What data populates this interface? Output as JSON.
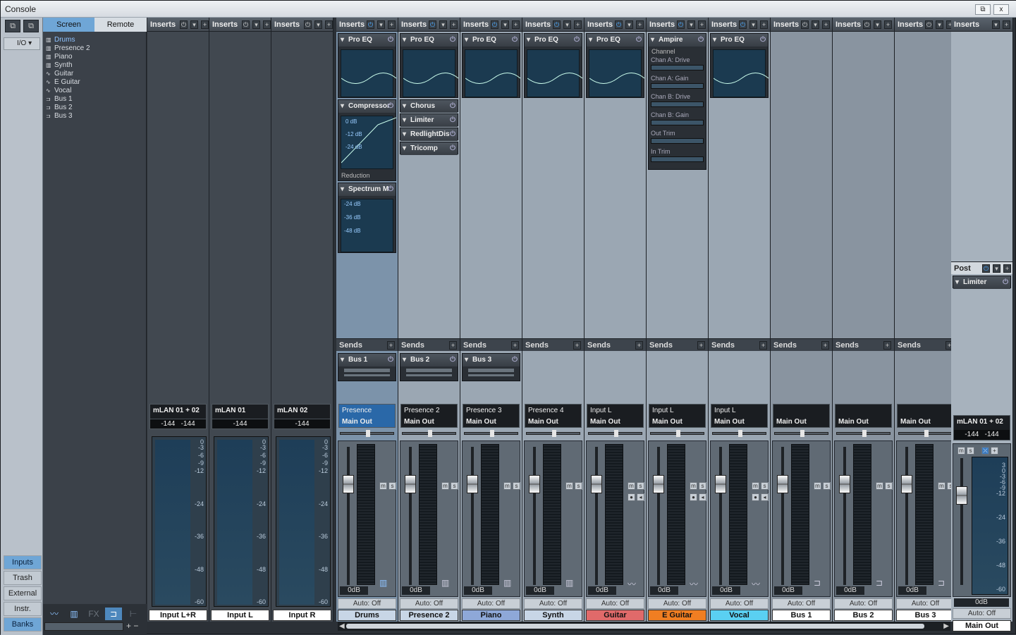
{
  "window": {
    "title": "Console",
    "restore_label": "⧉",
    "close_label": "x"
  },
  "left": {
    "io_label": "I/O",
    "tabs": [
      {
        "label": "Inputs"
      },
      {
        "label": "Trash"
      },
      {
        "label": "External"
      },
      {
        "label": "Instr."
      },
      {
        "label": "Banks"
      }
    ]
  },
  "browser": {
    "tab_screen": "Screen",
    "tab_remote": "Remote",
    "items": [
      {
        "label": "Drums",
        "icon": "keyboard-icon"
      },
      {
        "label": "Presence 2",
        "icon": "keyboard-icon"
      },
      {
        "label": "Piano",
        "icon": "keyboard-icon"
      },
      {
        "label": "Synth",
        "icon": "keyboard-icon"
      },
      {
        "label": "Guitar",
        "icon": "wave-icon"
      },
      {
        "label": "E Guitar",
        "icon": "wave-icon"
      },
      {
        "label": "Vocal",
        "icon": "wave-icon"
      },
      {
        "label": "Bus 1",
        "icon": "bus-icon"
      },
      {
        "label": "Bus 2",
        "icon": "bus-icon"
      },
      {
        "label": "Bus 3",
        "icon": "bus-icon"
      }
    ]
  },
  "labels": {
    "inserts": "Inserts",
    "sends": "Sends",
    "post": "Post",
    "auto": "Auto: Off",
    "db": "0dB",
    "reduction": "Reduction",
    "channel": "Channel"
  },
  "inputs": [
    {
      "src": "mLAN 01 + 02",
      "level": "-144   -144",
      "name": "Input L+R"
    },
    {
      "src": "mLAN 01",
      "level": "-144",
      "name": "Input L"
    },
    {
      "src": "mLAN 02",
      "level": "-144",
      "name": "Input R"
    }
  ],
  "meter_ticks": [
    "0",
    "-3",
    "-6",
    "-9",
    "-12",
    "-24",
    "-36",
    "-48",
    "-60"
  ],
  "channels": [
    {
      "name": "Drums",
      "in": "Presence",
      "out": "Main Out",
      "color": "#c8d6e6",
      "inserts": [
        "Pro EQ",
        "Compressor",
        "Spectrum M"
      ],
      "send": "Bus 1"
    },
    {
      "name": "Presence 2",
      "in": "Presence 2",
      "out": "Main Out",
      "color": "#c8d6e6",
      "inserts": [
        "Pro EQ",
        "Chorus",
        "Limiter",
        "RedlightDis",
        "Tricomp"
      ],
      "send": "Bus 2"
    },
    {
      "name": "Piano",
      "in": "Presence 3",
      "out": "Main Out",
      "color": "#8ea8d8",
      "inserts": [
        "Pro EQ"
      ],
      "send": "Bus 3"
    },
    {
      "name": "Synth",
      "in": "Presence 4",
      "out": "Main Out",
      "color": "#c8d6e6",
      "inserts": [
        "Pro EQ"
      ],
      "send": ""
    },
    {
      "name": "Guitar",
      "in": "Input L",
      "out": "Main Out",
      "color": "#e06a6a",
      "inserts": [
        "Pro EQ"
      ],
      "send": ""
    },
    {
      "name": "E Guitar",
      "in": "Input L",
      "out": "Main Out",
      "color": "#f07e22",
      "inserts": [
        "Ampire"
      ],
      "send": ""
    },
    {
      "name": "Vocal",
      "in": "Input L",
      "out": "Main Out",
      "color": "#5ad0f2",
      "inserts": [
        "Pro EQ"
      ],
      "send": ""
    },
    {
      "name": "Bus 1",
      "in": "",
      "out": "Main Out",
      "color": "#ffffff",
      "inserts": [],
      "send": ""
    },
    {
      "name": "Bus 2",
      "in": "",
      "out": "Main Out",
      "color": "#ffffff",
      "inserts": [],
      "send": ""
    },
    {
      "name": "Bus 3",
      "in": "",
      "out": "Main Out",
      "color": "#ffffff",
      "inserts": [],
      "send": ""
    }
  ],
  "compressor": {
    "ticks": [
      "0 dB",
      "-12 dB",
      "-24 dB"
    ]
  },
  "spectrum": {
    "ticks": [
      "-24 dB",
      "-36 dB",
      "-48 dB"
    ]
  },
  "ampire": {
    "params": [
      "Chan A: Drive",
      "Chan A: Gain",
      "Chan B: Drive",
      "Chan B: Gain",
      "Out Trim",
      "In Trim"
    ]
  },
  "main": {
    "src": "mLAN 01 + 02",
    "level": "-144   -144",
    "post_insert": "Limiter",
    "name": "Main Out",
    "ticks": [
      "3",
      "0",
      "-3",
      "-6",
      "-9",
      "-12",
      "-24",
      "-36",
      "-48",
      "-60"
    ]
  }
}
